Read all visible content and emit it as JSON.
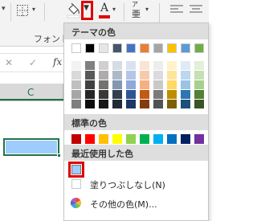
{
  "ribbon": {
    "group_label": "フォント",
    "fill_chevron": "▼",
    "font_color_letter": "A",
    "phonetic_letter": "ア",
    "phonetic_small": "亜"
  },
  "formula_bar": {
    "cancel_symbol": "✕",
    "confirm_symbol": "✓",
    "fx_label": "fx"
  },
  "sheet": {
    "column_label": "C",
    "selected_cell_color": "#9fccff"
  },
  "fill_menu": {
    "theme_colors_title": "テーマの色",
    "theme_columns": [
      [
        "#ffffff",
        "#f2f2f2",
        "#d9d9d9",
        "#bfbfbf",
        "#a6a6a6",
        "#7f7f7f"
      ],
      [
        "#000000",
        "#808080",
        "#595959",
        "#404040",
        "#262626",
        "#0d0d0d"
      ],
      [
        "#e7e6e6",
        "#d0cece",
        "#aeabab",
        "#757171",
        "#3b3838",
        "#171616"
      ],
      [
        "#44546a",
        "#d6dce4",
        "#acb9ca",
        "#8497b0",
        "#333f4f",
        "#222a35"
      ],
      [
        "#4472c4",
        "#d9e2f3",
        "#b4c6e7",
        "#8eaadb",
        "#2f5496",
        "#1f3864"
      ],
      [
        "#ed7d31",
        "#fbe4d5",
        "#f7caac",
        "#f4b083",
        "#c45911",
        "#833c0b"
      ],
      [
        "#a5a5a5",
        "#ededed",
        "#dbdbdb",
        "#c9c9c9",
        "#7b7b7b",
        "#525252"
      ],
      [
        "#ffc000",
        "#fff2cc",
        "#ffe599",
        "#ffd966",
        "#bf8f00",
        "#7f6000"
      ],
      [
        "#5b9bd5",
        "#deebf6",
        "#bdd7ee",
        "#9cc3e5",
        "#2e75b5",
        "#1f4e79"
      ],
      [
        "#70ad47",
        "#e2efd9",
        "#c5e0b3",
        "#a8d08d",
        "#538135",
        "#375623"
      ]
    ],
    "standard_colors_title": "標準の色",
    "standard_colors": [
      "#c00000",
      "#ff0000",
      "#ffc000",
      "#ffff00",
      "#92d050",
      "#00b050",
      "#00b0f0",
      "#0070c0",
      "#002060",
      "#7030a0"
    ],
    "recent_colors_title": "最近使用した色",
    "recent_colors": [
      "#9fccff"
    ],
    "no_fill_label": "塗りつぶしなし(N)",
    "more_colors_label": "その他の色(M)..."
  }
}
